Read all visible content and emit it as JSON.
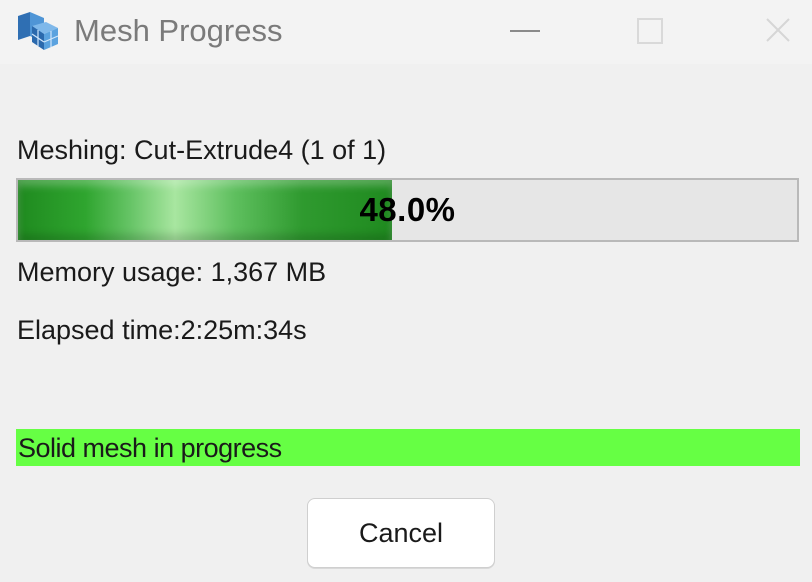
{
  "window": {
    "title": "Mesh Progress",
    "app_icon": "mesh-app-icon",
    "controls": {
      "minimize_icon": "minimize-icon",
      "maximize_icon": "maximize-icon",
      "close_icon": "close-icon"
    }
  },
  "progress": {
    "meshing_label": "Meshing: Cut-Extrude4 (1 of 1)",
    "percent_text": "48.0%",
    "fraction": 0.48,
    "memory_label": "Memory usage: 1,367 MB",
    "elapsed_label": "Elapsed time:2:25m:34s"
  },
  "status": {
    "text": "Solid mesh in progress",
    "color": "#66ff44"
  },
  "buttons": {
    "cancel_label": "Cancel"
  },
  "colors": {
    "progress_fill": "#2fa52f",
    "title_text": "#7a7a7a"
  }
}
